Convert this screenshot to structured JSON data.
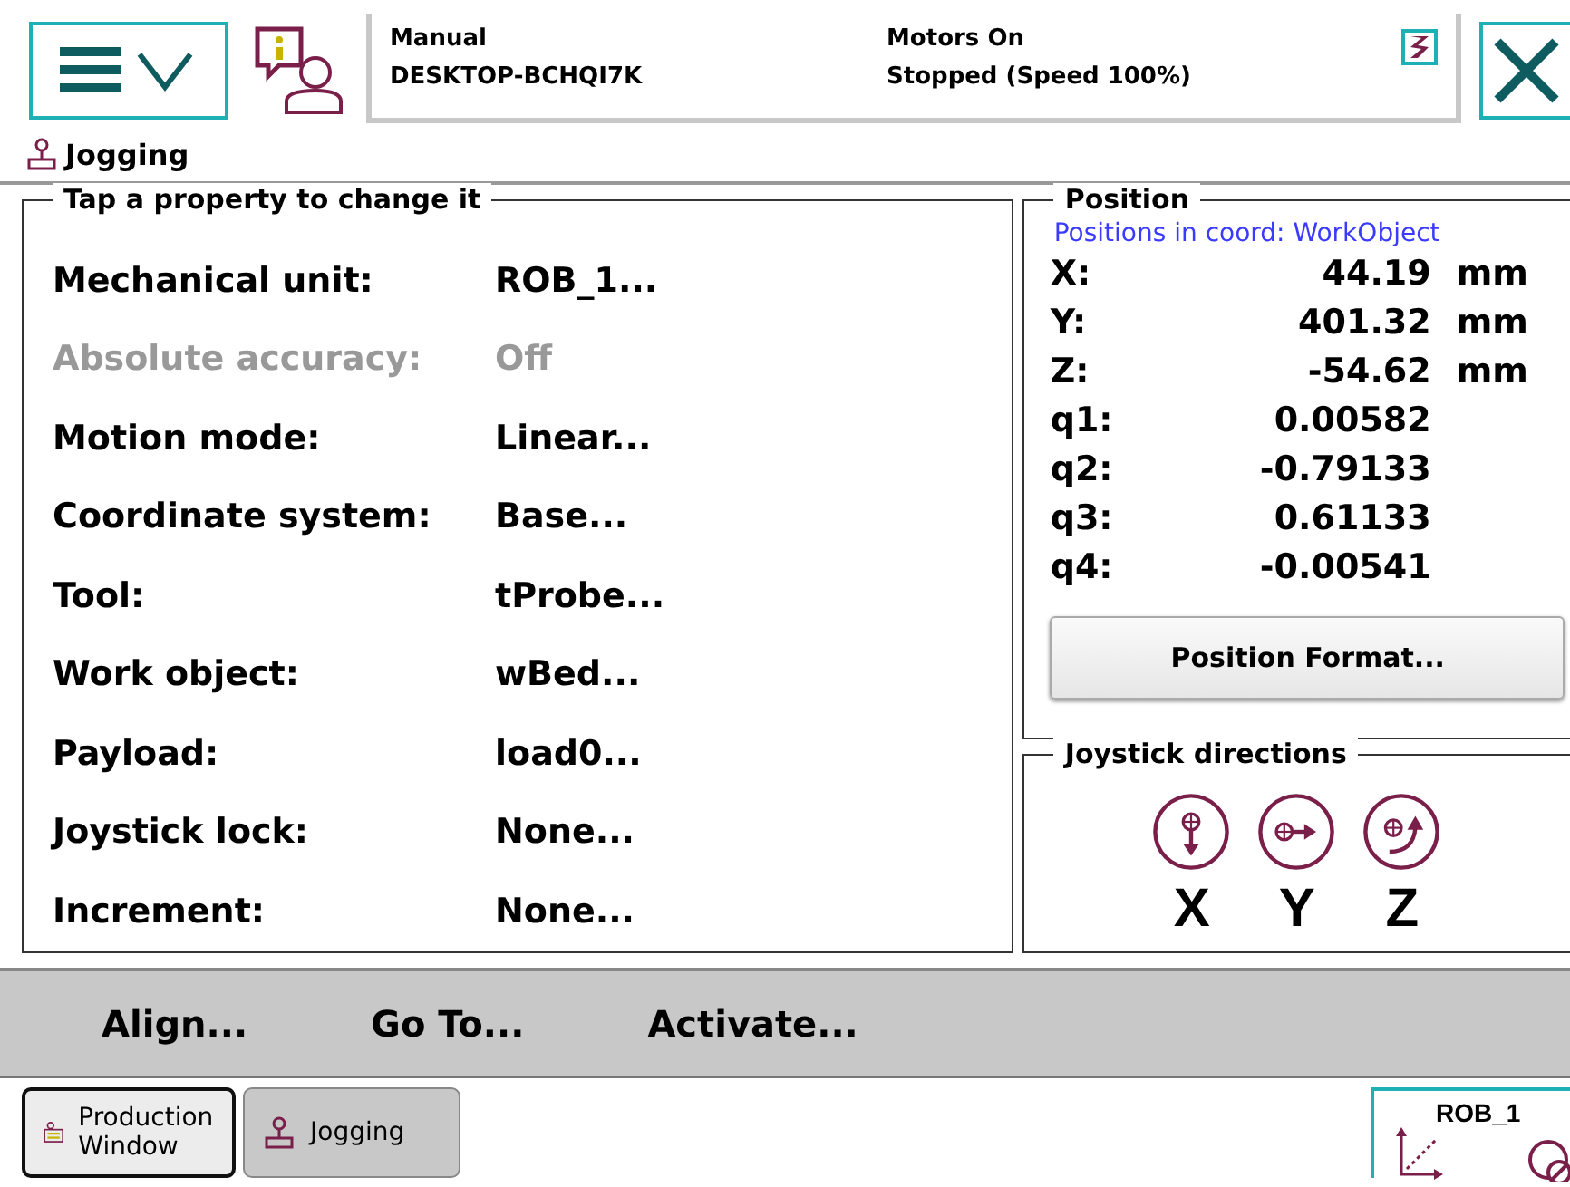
{
  "header": {
    "status": [
      {
        "top": "Manual",
        "bottom": "DESKTOP-BCHQI7K"
      },
      {
        "top": "Motors On",
        "bottom": "Stopped (Speed 100%)"
      }
    ]
  },
  "view_title": "Jogging",
  "properties": {
    "title": "Tap a property to change it",
    "rows": [
      {
        "label": "Mechanical unit:",
        "value": "ROB_1...",
        "disabled": false
      },
      {
        "label": "Absolute accuracy:",
        "value": "Off",
        "disabled": true
      },
      {
        "label": "Motion mode:",
        "value": "Linear...",
        "disabled": false
      },
      {
        "label": "Coordinate system:",
        "value": "Base...",
        "disabled": false
      },
      {
        "label": "Tool:",
        "value": "tProbe...",
        "disabled": false
      },
      {
        "label": "Work object:",
        "value": "wBed...",
        "disabled": false
      },
      {
        "label": "Payload:",
        "value": "load0...",
        "disabled": false
      },
      {
        "label": "Joystick lock:",
        "value": "None...",
        "disabled": false
      },
      {
        "label": "Increment:",
        "value": "None...",
        "disabled": false
      }
    ]
  },
  "position": {
    "title": "Position",
    "coord_note": "Positions in coord: WorkObject",
    "rows": [
      {
        "label": "X:",
        "value": "44.19",
        "unit": "mm"
      },
      {
        "label": "Y:",
        "value": "401.32",
        "unit": "mm"
      },
      {
        "label": "Z:",
        "value": "-54.62",
        "unit": "mm"
      },
      {
        "label": "q1:",
        "value": "0.00582"
      },
      {
        "label": "q2:",
        "value": "-0.79133"
      },
      {
        "label": "q3:",
        "value": "0.61133"
      },
      {
        "label": "q4:",
        "value": "-0.00541"
      }
    ],
    "button": "Position Format..."
  },
  "joystick": {
    "title": "Joystick directions",
    "axes": [
      {
        "label": "X",
        "kind": "down"
      },
      {
        "label": "Y",
        "kind": "right"
      },
      {
        "label": "Z",
        "kind": "rotate"
      }
    ]
  },
  "commands": [
    "Align...",
    "Go To...",
    "Activate..."
  ],
  "taskbar": [
    {
      "label": "Production Window",
      "kind": "production",
      "selected": false
    },
    {
      "label": "Jogging",
      "kind": "jogging",
      "selected": true
    }
  ],
  "quickset": {
    "label": "ROB_1"
  }
}
